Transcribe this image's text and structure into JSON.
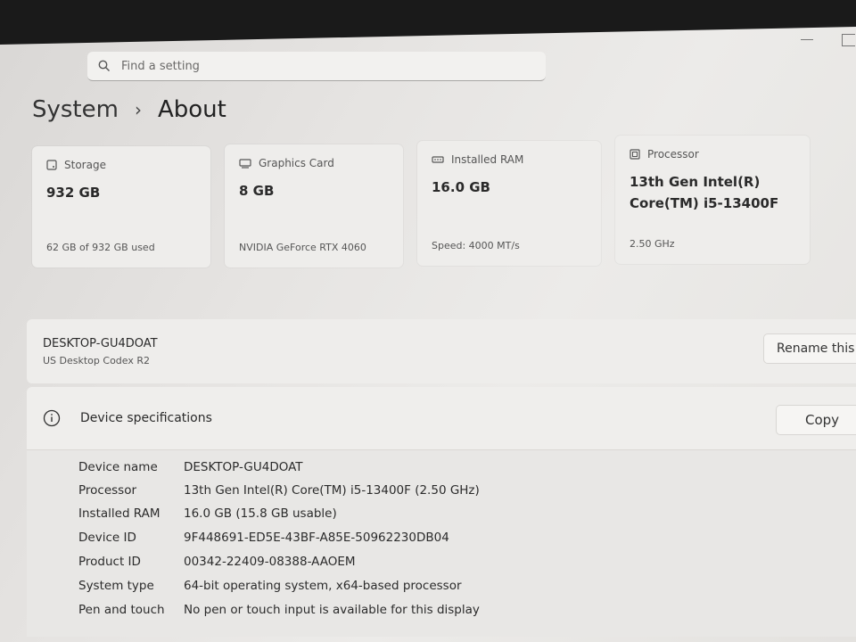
{
  "search": {
    "placeholder": "Find a setting"
  },
  "breadcrumb": {
    "parent": "System",
    "separator": "›",
    "current": "About"
  },
  "cards": [
    {
      "icon": "storage-icon",
      "label": "Storage",
      "value": "932 GB",
      "value2": "",
      "footer": "62 GB of 932 GB used"
    },
    {
      "icon": "graphics-card-icon",
      "label": "Graphics Card",
      "value": "8 GB",
      "value2": "",
      "footer": "NVIDIA GeForce RTX 4060"
    },
    {
      "icon": "ram-icon",
      "label": "Installed RAM",
      "value": "16.0 GB",
      "value2": "",
      "footer": "Speed: 4000 MT/s"
    },
    {
      "icon": "processor-icon",
      "label": "Processor",
      "value": "13th Gen Intel(R)",
      "value2": "Core(TM) i5-13400F",
      "footer": "2.50 GHz"
    }
  ],
  "device": {
    "name": "DESKTOP-GU4DOAT",
    "model": "US Desktop Codex R2",
    "rename_label": "Rename this"
  },
  "specs": {
    "title": "Device specifications",
    "copy_label": "Copy",
    "rows": [
      {
        "label": "Device name",
        "value": "DESKTOP-GU4DOAT"
      },
      {
        "label": "Processor",
        "value": "13th Gen Intel(R) Core(TM) i5-13400F (2.50 GHz)"
      },
      {
        "label": "Installed RAM",
        "value": "16.0 GB (15.8 GB usable)"
      },
      {
        "label": "Device ID",
        "value": "9F448691-ED5E-43BF-A85E-50962230DB04"
      },
      {
        "label": "Product ID",
        "value": "00342-22409-08388-AAOEM"
      },
      {
        "label": "System type",
        "value": "64-bit operating system, x64-based processor"
      },
      {
        "label": "Pen and touch",
        "value": "No pen or touch input is available for this display"
      }
    ]
  }
}
